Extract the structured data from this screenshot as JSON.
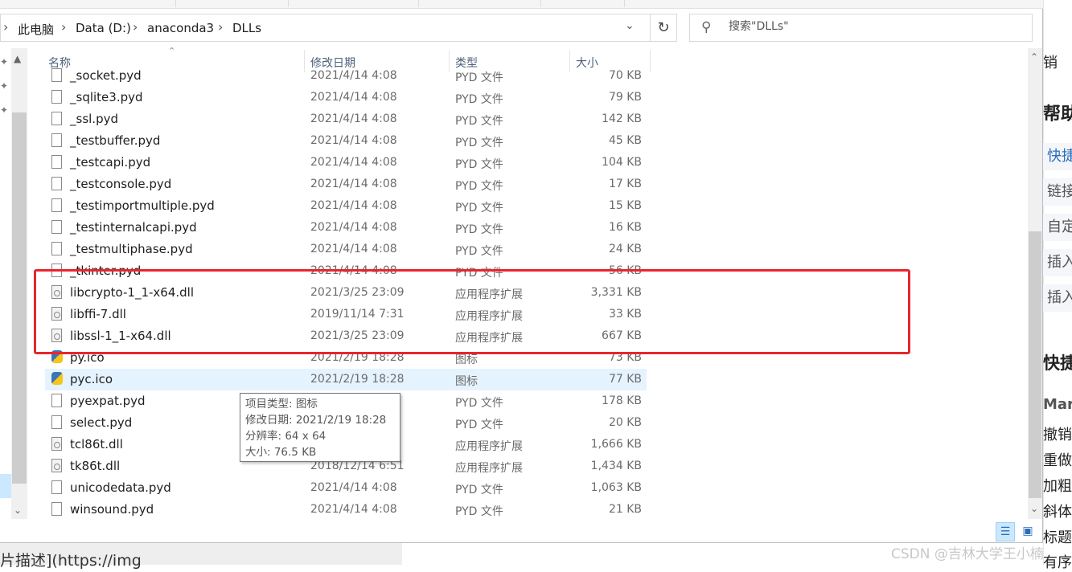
{
  "address": {
    "crumbs": [
      "此电脑",
      "Data (D:)",
      "anaconda3",
      "DLLs"
    ],
    "chevron": "›"
  },
  "search": {
    "placeholder": "搜索\"DLLs\""
  },
  "columns": {
    "name": "名称",
    "date": "修改日期",
    "type": "类型",
    "size": "大小"
  },
  "files": [
    {
      "name": "_socket.pyd",
      "date": "2021/4/14 4:08",
      "type": "PYD 文件",
      "size": "70 KB",
      "icon": "file-icon"
    },
    {
      "name": "_sqlite3.pyd",
      "date": "2021/4/14 4:08",
      "type": "PYD 文件",
      "size": "79 KB",
      "icon": "file-icon"
    },
    {
      "name": "_ssl.pyd",
      "date": "2021/4/14 4:08",
      "type": "PYD 文件",
      "size": "142 KB",
      "icon": "file-icon"
    },
    {
      "name": "_testbuffer.pyd",
      "date": "2021/4/14 4:08",
      "type": "PYD 文件",
      "size": "45 KB",
      "icon": "file-icon"
    },
    {
      "name": "_testcapi.pyd",
      "date": "2021/4/14 4:08",
      "type": "PYD 文件",
      "size": "104 KB",
      "icon": "file-icon"
    },
    {
      "name": "_testconsole.pyd",
      "date": "2021/4/14 4:08",
      "type": "PYD 文件",
      "size": "17 KB",
      "icon": "file-icon"
    },
    {
      "name": "_testimportmultiple.pyd",
      "date": "2021/4/14 4:08",
      "type": "PYD 文件",
      "size": "15 KB",
      "icon": "file-icon"
    },
    {
      "name": "_testinternalcapi.pyd",
      "date": "2021/4/14 4:08",
      "type": "PYD 文件",
      "size": "16 KB",
      "icon": "file-icon"
    },
    {
      "name": "_testmultiphase.pyd",
      "date": "2021/4/14 4:08",
      "type": "PYD 文件",
      "size": "24 KB",
      "icon": "file-icon"
    },
    {
      "name": "_tkinter.pyd",
      "date": "2021/4/14 4:08",
      "type": "PYD 文件",
      "size": "56 KB",
      "icon": "file-icon"
    },
    {
      "name": "libcrypto-1_1-x64.dll",
      "date": "2021/3/25 23:09",
      "type": "应用程序扩展",
      "size": "3,331 KB",
      "icon": "dll-icon"
    },
    {
      "name": "libffi-7.dll",
      "date": "2019/11/14 7:31",
      "type": "应用程序扩展",
      "size": "33 KB",
      "icon": "dll-icon"
    },
    {
      "name": "libssl-1_1-x64.dll",
      "date": "2021/3/25 23:09",
      "type": "应用程序扩展",
      "size": "667 KB",
      "icon": "dll-icon"
    },
    {
      "name": "py.ico",
      "date": "2021/2/19 18:28",
      "type": "图标",
      "size": "73 KB",
      "icon": "python-icon"
    },
    {
      "name": "pyc.ico",
      "date": "2021/2/19 18:28",
      "type": "图标",
      "size": "77 KB",
      "icon": "python-icon",
      "selected": true
    },
    {
      "name": "pyexpat.pyd",
      "date": "",
      "type": "PYD 文件",
      "size": "178 KB",
      "icon": "file-icon"
    },
    {
      "name": "select.pyd",
      "date": "",
      "type": "PYD 文件",
      "size": "20 KB",
      "icon": "file-icon"
    },
    {
      "name": "tcl86t.dll",
      "date": "",
      "type": "应用程序扩展",
      "size": "1,666 KB",
      "icon": "dll-icon"
    },
    {
      "name": "tk86t.dll",
      "date": "2018/12/14 6:51",
      "type": "应用程序扩展",
      "size": "1,434 KB",
      "icon": "dll-icon"
    },
    {
      "name": "unicodedata.pyd",
      "date": "2021/4/14 4:08",
      "type": "PYD 文件",
      "size": "1,063 KB",
      "icon": "file-icon"
    },
    {
      "name": "winsound.pyd",
      "date": "2021/4/14 4:08",
      "type": "PYD 文件",
      "size": "21 KB",
      "icon": "file-icon"
    }
  ],
  "tooltip": {
    "type": "项目类型: 图标",
    "date": "修改日期: 2021/2/19 18:28",
    "resolution": "分辨率: 64 x 64",
    "size": "大小: 76.5 KB"
  },
  "background": {
    "right_items": [
      "销",
      "帮助",
      "快捷",
      "链接",
      "自定",
      "插入",
      "插入",
      "快捷",
      "Mark",
      "撤销",
      "重做",
      "加粗",
      "斜体",
      "标题",
      "有序"
    ],
    "bottom_left": "片描述](https://img",
    "watermark": "CSDN @吉林大学王小楠"
  },
  "colors": {
    "highlight": "#e8262c",
    "selection": "#e5f3ff"
  }
}
